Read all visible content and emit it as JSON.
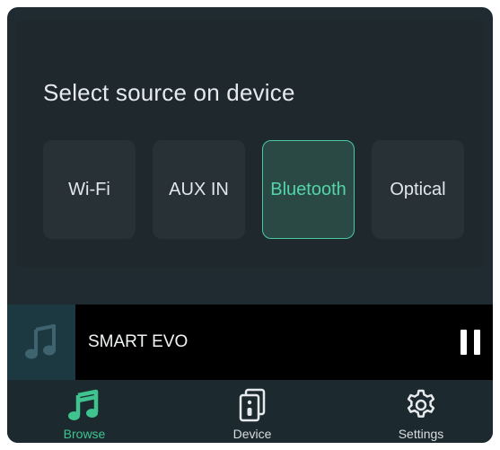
{
  "source_selector": {
    "title": "Select source on device",
    "options": [
      {
        "label": "Wi-Fi",
        "selected": false
      },
      {
        "label": "AUX IN",
        "selected": false
      },
      {
        "label": "Bluetooth",
        "selected": true
      },
      {
        "label": "Optical",
        "selected": false
      }
    ]
  },
  "mini_player": {
    "track": "SMART EVO",
    "artwork_icon": "music-note-icon",
    "control_icon": "pause-icon"
  },
  "tabs": [
    {
      "label": "Browse",
      "icon": "music-note-icon",
      "active": true
    },
    {
      "label": "Device",
      "icon": "speaker-device-icon",
      "active": false
    },
    {
      "label": "Settings",
      "icon": "gear-icon",
      "active": false
    }
  ],
  "colors": {
    "accent": "#3fc48f",
    "background": "#1f2b31",
    "button": "#273136",
    "selected_button": "#2a4844"
  }
}
